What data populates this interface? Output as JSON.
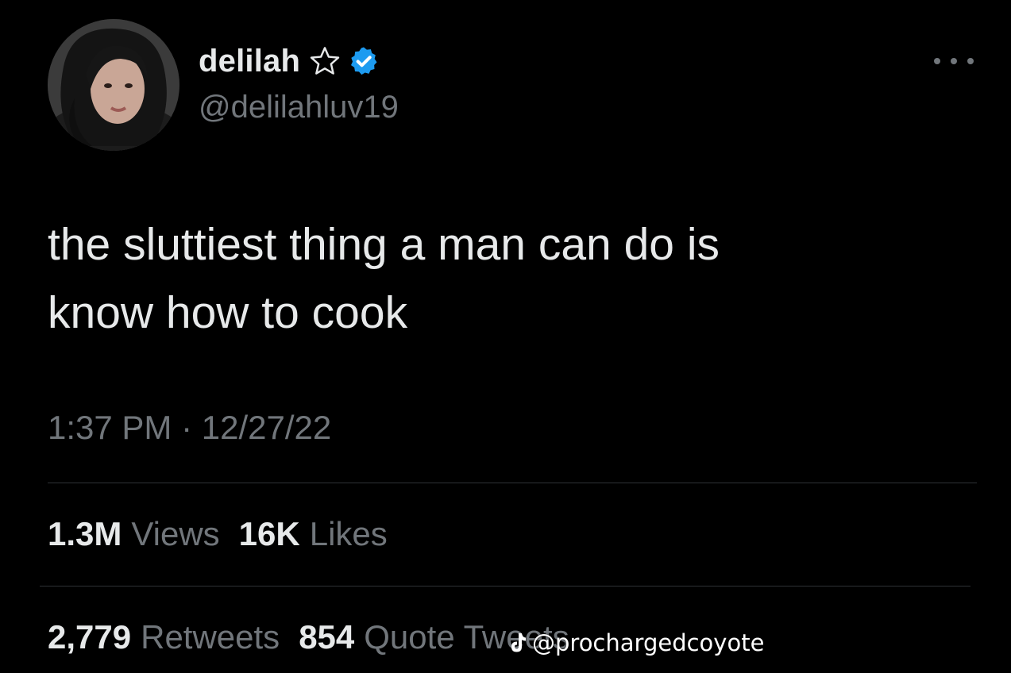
{
  "tweet": {
    "author": {
      "display_name": "delilah",
      "handle": "@delilahluv19",
      "avatar_icon": "profile-photo",
      "name_decoration_icon": "star-outline-icon",
      "verified": true,
      "verified_color": "#1d9bf0"
    },
    "more_menu_icon": "more-horizontal-icon",
    "text_lines": [
      "the sluttiest thing a man can do is",
      "know how to cook"
    ],
    "timestamp": "1:37 PM · 12/27/22",
    "stats_row_1": {
      "views_count": "1.3M",
      "views_label": "Views",
      "likes_count": "16K",
      "likes_label": "Likes"
    },
    "stats_row_2": {
      "retweets_count": "2,779",
      "retweets_label": "Retweets",
      "quotes_count": "854",
      "quotes_label": "Quote Tweets"
    }
  },
  "watermark": {
    "icon": "tiktok-icon",
    "text": "@prochargedcoyote"
  },
  "colors": {
    "background": "#000000",
    "primary_text": "#e7e9ea",
    "secondary_text": "#71767b",
    "divider": "#2f3336"
  }
}
